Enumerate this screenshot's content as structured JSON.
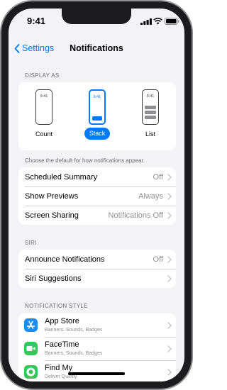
{
  "status": {
    "time": "9:41"
  },
  "nav": {
    "back_label": "Settings",
    "title": "Notifications"
  },
  "display_as": {
    "header": "DISPLAY AS",
    "options": [
      {
        "label": "Count",
        "preview_time": "9:41",
        "selected": false
      },
      {
        "label": "Stack",
        "preview_time": "9:41",
        "selected": true
      },
      {
        "label": "List",
        "preview_time": "9:41",
        "selected": false
      }
    ],
    "footer": "Choose the default for how notifications appear."
  },
  "general": [
    {
      "label": "Scheduled Summary",
      "value": "Off"
    },
    {
      "label": "Show Previews",
      "value": "Always"
    },
    {
      "label": "Screen Sharing",
      "value": "Notifications Off"
    }
  ],
  "siri": {
    "header": "SIRI",
    "rows": [
      {
        "label": "Announce Notifications",
        "value": "Off"
      },
      {
        "label": "Siri Suggestions",
        "value": ""
      }
    ]
  },
  "notification_style": {
    "header": "NOTIFICATION STYLE",
    "apps": [
      {
        "name": "App Store",
        "subtitle": "Banners, Sounds, Badges",
        "icon": "app-store-icon",
        "color": "#1a8cf6"
      },
      {
        "name": "FaceTime",
        "subtitle": "Banners, Sounds, Badges",
        "icon": "facetime-icon",
        "color": "#34c759"
      },
      {
        "name": "Find My",
        "subtitle": "Deliver Quietly",
        "icon": "find-my-icon",
        "color": "#34c759"
      }
    ]
  },
  "colors": {
    "accent": "#007aff",
    "background": "#f2f2f7"
  }
}
